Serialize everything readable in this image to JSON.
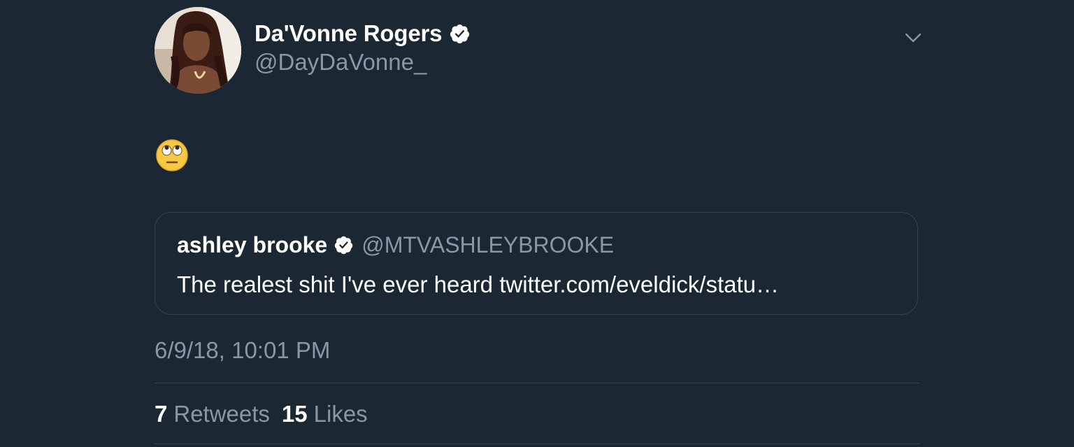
{
  "tweet": {
    "author": {
      "display_name": "Da'Vonne Rogers",
      "handle": "@DayDaVonne_",
      "verified": true,
      "avatar_icon": "profile-photo"
    },
    "text_emoji": "face-with-rolling-eyes",
    "menu_icon": "chevron-down-icon",
    "quoted_tweet": {
      "display_name": "ashley brooke",
      "handle": "@MTVASHLEYBROOKE",
      "verified": true,
      "text": "The realest shit I've ever heard twitter.com/eveldick/statu…"
    },
    "timestamp": "6/9/18, 10:01 PM",
    "stats": {
      "retweets_count": "7",
      "retweets_label": "Retweets",
      "likes_count": "15",
      "likes_label": "Likes"
    }
  },
  "colors": {
    "background": "#1b2733",
    "primary_text": "#ffffff",
    "secondary_text": "#8899a6",
    "border": "#38444d"
  }
}
